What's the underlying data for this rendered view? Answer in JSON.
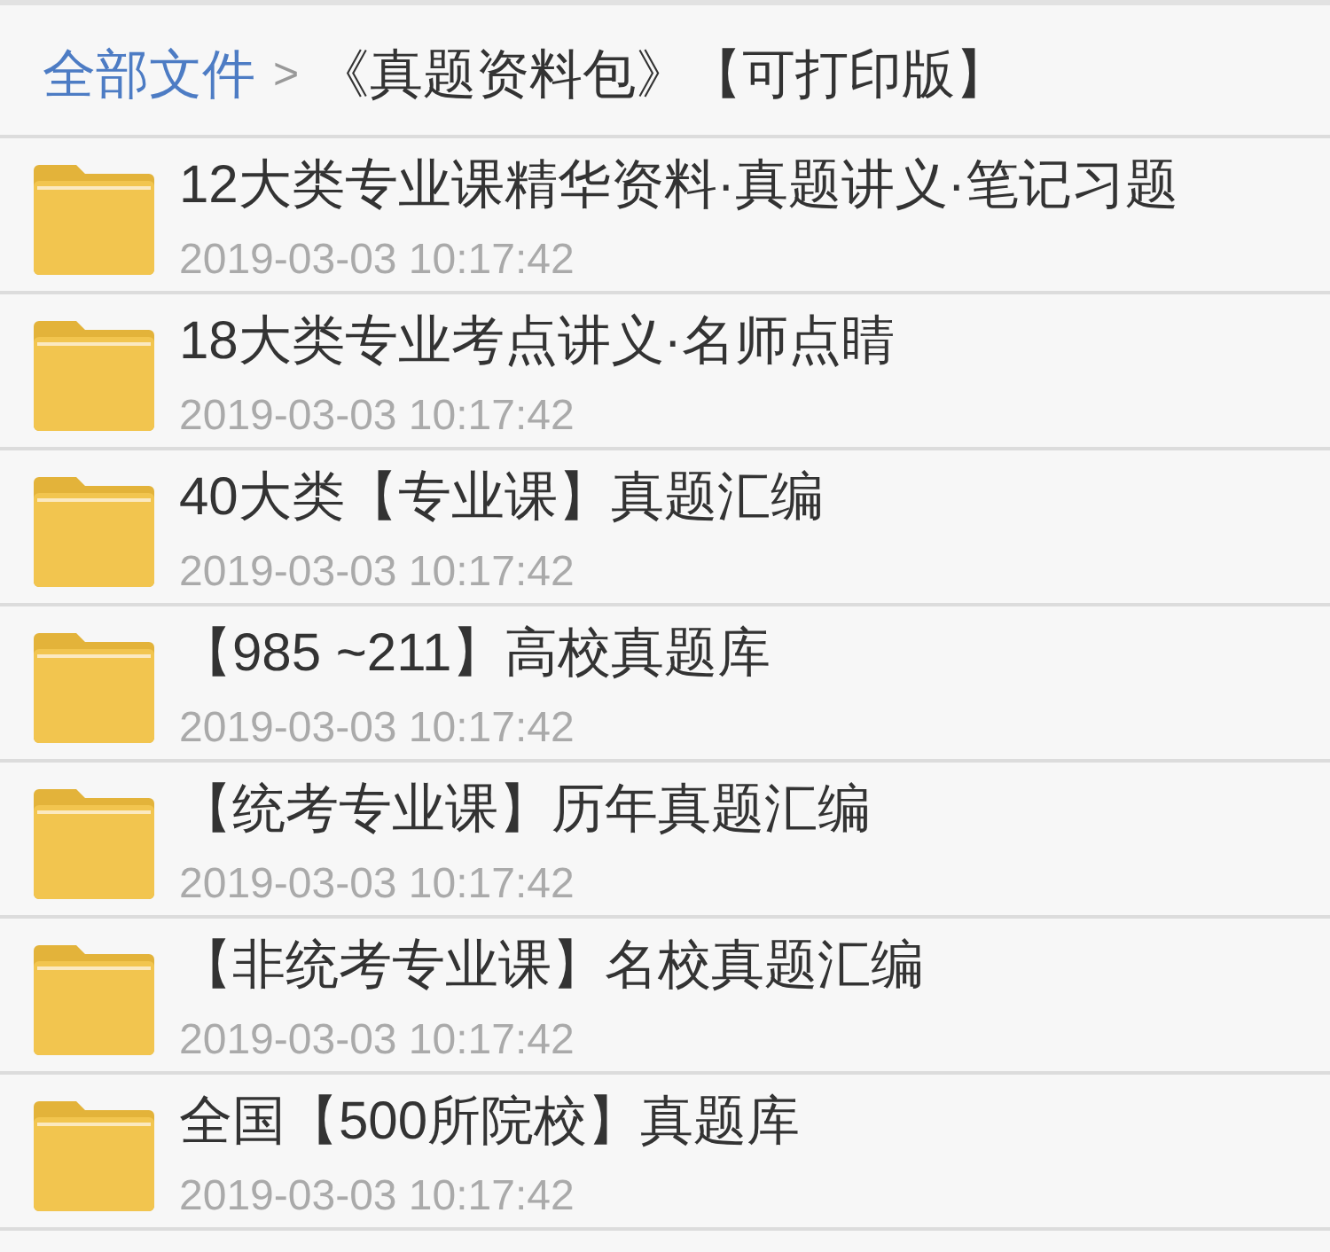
{
  "breadcrumb": {
    "root": "全部文件",
    "separator": ">",
    "current": "《真题资料包》【可打印版】"
  },
  "files": [
    {
      "name": "12大类专业课精华资料·真题讲义·笔记习题",
      "modified": "2019-03-03 10:17:42"
    },
    {
      "name": "18大类专业考点讲义·名师点睛",
      "modified": "2019-03-03 10:17:42"
    },
    {
      "name": "40大类【专业课】真题汇编",
      "modified": "2019-03-03 10:17:42"
    },
    {
      "name": "【985 ~211】高校真题库",
      "modified": "2019-03-03 10:17:42"
    },
    {
      "name": "【统考专业课】历年真题汇编",
      "modified": "2019-03-03 10:17:42"
    },
    {
      "name": "【非统考专业课】名校真题汇编",
      "modified": "2019-03-03 10:17:42"
    },
    {
      "name": "全国【500所院校】真题库",
      "modified": "2019-03-03 10:17:42"
    }
  ]
}
